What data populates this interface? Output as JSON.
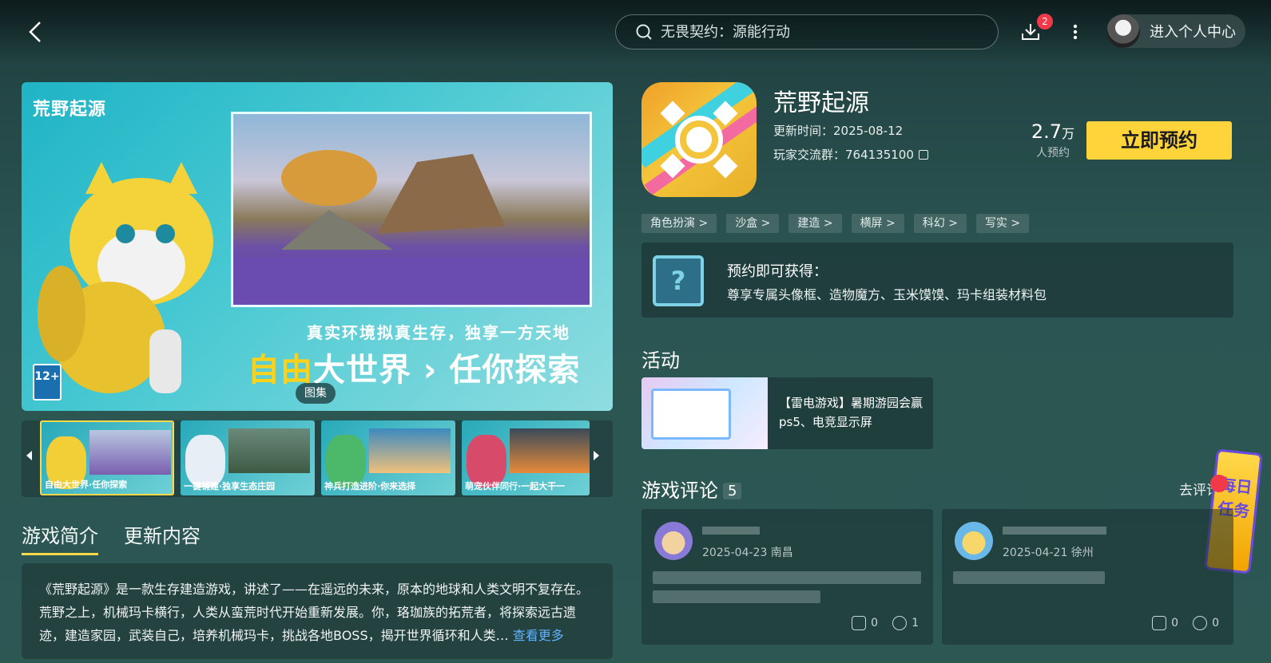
{
  "header": {
    "search_placeholder": "无畏契约：源能行动",
    "download_count": "2",
    "user_center_label": "进入个人中心"
  },
  "hero": {
    "logo_text": "荒野起源",
    "tagline": "真实环境拟真生存，独享一方天地",
    "headline_a": "自由",
    "headline_b": "大世界",
    "headline_c": "任你探索",
    "age_rating": "12+",
    "gallery_label": "图集"
  },
  "thumbnails": [
    {
      "caption": "自由大世界·任你探索"
    },
    {
      "caption": "一键铺建·独享生态庄园"
    },
    {
      "caption": "神兵打造进阶·你来选择"
    },
    {
      "caption": "萌宠伙伴同行·一起大干一"
    }
  ],
  "tabs": [
    "游戏简介",
    "更新内容"
  ],
  "intro": {
    "text": "《荒野起源》是一款生存建造游戏，讲述了——在遥远的未来，原本的地球和人类文明不复存在。荒野之上，机械玛卡横行，人类从蛮荒时代开始重新发展。你，珞珈族的拓荒者，将探索远古遗迹，建造家园，武装自己，培养机械玛卡，挑战各地BOSS，揭开世界循环和人类…",
    "more_label": "查看更多"
  },
  "game": {
    "title": "荒野起源",
    "update_time": "更新时间：2025-08-12",
    "group": "玩家交流群：764135100",
    "reserve_count": "2.7",
    "reserve_unit": "万",
    "reserve_label": "人预约",
    "reserve_button": "立即预约"
  },
  "tags": [
    "角色扮演 >",
    "沙盒 >",
    "建造 >",
    "横屏 >",
    "科幻 >",
    "写实 >"
  ],
  "reward": {
    "title": "预约即可获得：",
    "items": "尊享专属头像框、造物魔方、玉米馍馍、玛卡组装材料包"
  },
  "activity": {
    "section_title": "活动",
    "text": "【雷电游戏】暑期游园会赢ps5、电竞显示屏"
  },
  "reviews": {
    "section_title": "游戏评论",
    "count": "5",
    "write_label": "去评论",
    "task_label": "每日任务",
    "items": [
      {
        "date": "2025-04-23 南昌",
        "likes": "0",
        "comments": "1"
      },
      {
        "date": "2025-04-21 徐州",
        "likes": "0",
        "comments": "0"
      }
    ]
  }
}
